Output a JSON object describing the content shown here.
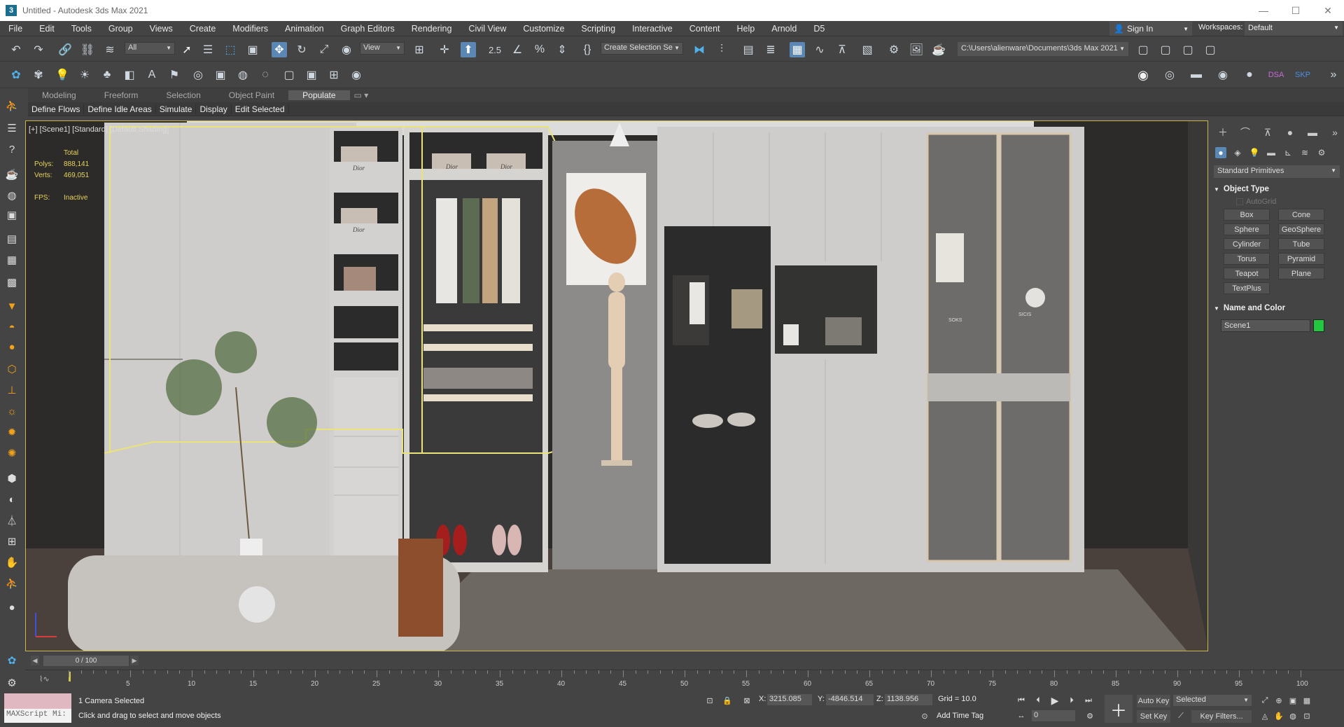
{
  "window": {
    "app_letter": "3",
    "title": "Untitled - Autodesk 3ds Max 2021",
    "controls": [
      "—",
      "☐",
      "✕"
    ]
  },
  "menu": [
    "File",
    "Edit",
    "Tools",
    "Group",
    "Views",
    "Create",
    "Modifiers",
    "Animation",
    "Graph Editors",
    "Rendering",
    "Civil View",
    "Customize",
    "Scripting",
    "Interactive",
    "Content",
    "Help",
    "Arnold",
    "D5"
  ],
  "account": {
    "sign_in": "Sign In",
    "workspaces_label": "Workspaces:",
    "workspace_value": "Default"
  },
  "toolbar": {
    "selection_filter": "All",
    "reference_coord": "View",
    "snap_label": "2.5",
    "named_selection": "Create Selection Se",
    "project_path": "C:\\Users\\alienware\\Documents\\3ds Max 2021"
  },
  "ribbon": {
    "tabs": [
      "Modeling",
      "Freeform",
      "Selection",
      "Object Paint",
      "Populate"
    ],
    "active_tab": "Populate",
    "subtools": [
      "Define Flows",
      "Define Idle Areas",
      "Simulate",
      "Display",
      "Edit Selected"
    ]
  },
  "viewport": {
    "label": "[+] [Scene1] [Standard] [Default Shading]",
    "stats": {
      "total_label": "Total",
      "polys_label": "Polys:",
      "polys_value": "888,141",
      "verts_label": "Verts:",
      "verts_value": "469,051",
      "fps_label": "FPS:",
      "fps_value": "Inactive"
    },
    "brand_text": "Dior",
    "shelf_text": [
      "SOKS",
      "SICIS"
    ]
  },
  "command_panel": {
    "category": "Standard Primitives",
    "object_type_label": "Object Type",
    "autogrid_label": "AutoGrid",
    "primitives": [
      "Box",
      "Cone",
      "Sphere",
      "GeoSphere",
      "Cylinder",
      "Tube",
      "Torus",
      "Pyramid",
      "Teapot",
      "Plane",
      "TextPlus"
    ],
    "name_color_label": "Name and Color",
    "object_name": "Scene1",
    "object_color": "#22c840"
  },
  "timeline": {
    "frame_display": "0 / 100",
    "ticks": [
      "5",
      "10",
      "15",
      "20",
      "25",
      "30",
      "35",
      "40",
      "45",
      "50",
      "55",
      "60",
      "65",
      "70",
      "75",
      "80",
      "85",
      "90",
      "95",
      "100"
    ]
  },
  "status": {
    "maxscript_label": "MAXScript Mi:",
    "selection_info": "1 Camera Selected",
    "prompt": "Click and drag to select and move objects",
    "x_label": "X:",
    "x_value": "3215.085",
    "y_label": "Y:",
    "y_value": "-4846.514",
    "z_label": "Z:",
    "z_value": "1138.956",
    "grid": "Grid = 10.0",
    "add_time_tag": "Add Time Tag",
    "auto_key": "Auto Key",
    "set_key": "Set Key",
    "selected_dd": "Selected",
    "key_filters": "Key Filters...",
    "frame_field": "0"
  }
}
